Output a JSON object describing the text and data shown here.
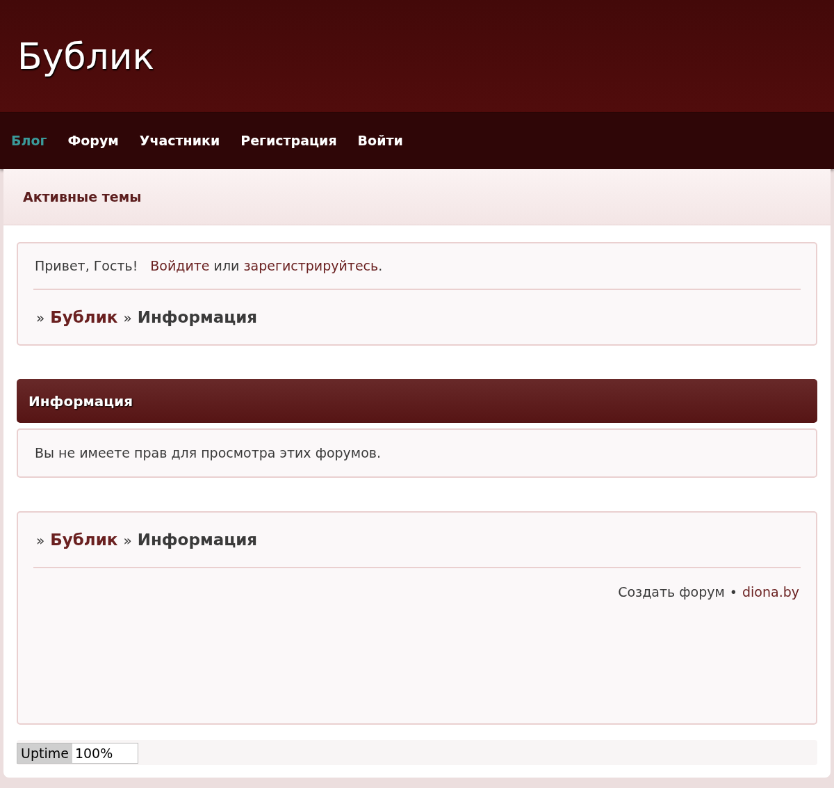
{
  "site_title": "Бублик",
  "nav": [
    {
      "label": "Блог",
      "selected": true
    },
    {
      "label": "Форум",
      "selected": false
    },
    {
      "label": "Участники",
      "selected": false
    },
    {
      "label": "Регистрация",
      "selected": false
    },
    {
      "label": "Войти",
      "selected": false
    }
  ],
  "subheader": "Активные темы",
  "greeting": {
    "text": "Привет, Гость!",
    "parts": [
      {
        "kind": "link",
        "text": "Войдите"
      },
      {
        "kind": "text",
        "text": " или "
      },
      {
        "kind": "link",
        "text": "зарегистрируйтесь"
      },
      {
        "kind": "text",
        "text": "."
      }
    ]
  },
  "breadcrumb_top": [
    {
      "kind": "sep",
      "text": "»"
    },
    {
      "kind": "link",
      "text": "Бублик"
    },
    {
      "kind": "sep",
      "text": "»"
    },
    {
      "kind": "current",
      "text": "Информация"
    }
  ],
  "info": {
    "title": "Информация",
    "message": "Вы не имеете прав для просмотра этих форумов."
  },
  "breadcrumb_bottom": [
    {
      "kind": "sep",
      "text": "»"
    },
    {
      "kind": "link",
      "text": "Бублик"
    },
    {
      "kind": "sep",
      "text": "»"
    },
    {
      "kind": "current",
      "text": "Информация"
    }
  ],
  "footer": [
    {
      "kind": "text",
      "text": "Создать форум"
    },
    {
      "kind": "text",
      "text": "•"
    },
    {
      "kind": "link",
      "text": "diona.by"
    }
  ],
  "uptime": {
    "label": "Uptime",
    "value": "100%"
  }
}
